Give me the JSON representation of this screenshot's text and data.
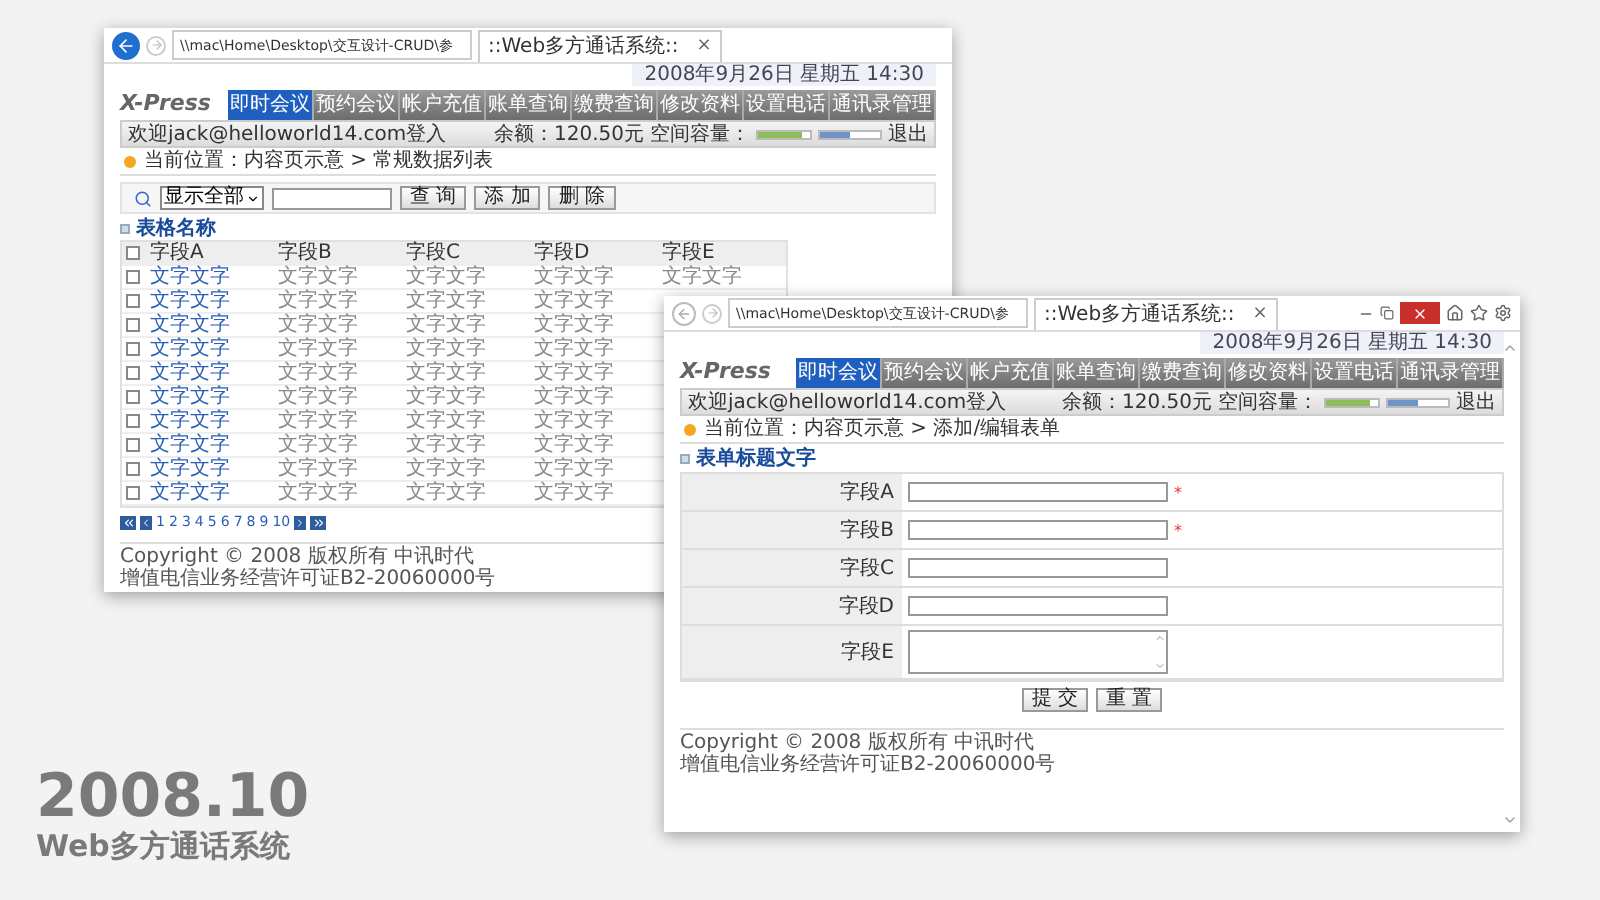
{
  "windows": [
    {
      "kind": "list",
      "address": "\\\\mac\\Home\\Desktop\\交互设计-CRUD\\参",
      "tab_title": "::Web多方通话系统::",
      "tab_close": "×",
      "date": "2008年9月26日  星期五  14:30",
      "logo": "X-Press",
      "nav": [
        {
          "label": "即时会议",
          "selected": true
        },
        {
          "label": "预约会议",
          "selected": false
        },
        {
          "label": "帐户充值",
          "selected": false
        },
        {
          "label": "账单查询",
          "selected": false
        },
        {
          "label": "缴费查询",
          "selected": false
        },
        {
          "label": "修改资料",
          "selected": false
        },
        {
          "label": "设置电话",
          "selected": false
        },
        {
          "label": "通讯录管理",
          "selected": false
        }
      ],
      "welcome": "欢迎jack@helloworld14.com登入",
      "balance": "余额：120.50元",
      "space_label": "空间容量：",
      "meters": [
        {
          "level": 0.85,
          "color": "#8cbf5a"
        },
        {
          "level": 0.5,
          "color": "#6f95c8"
        }
      ],
      "logout": "退出",
      "breadcrumb": "当前位置：内容页示意 > 常规数据列表",
      "search": {
        "select": "显示全部",
        "buttons": [
          "查 询",
          "添 加",
          "删 除"
        ]
      },
      "section_title": "表格名称",
      "table": {
        "select_all": {
          "checked": false
        },
        "columns": [
          "字段A",
          "字段B",
          "字段C",
          "字段D",
          "字段E"
        ],
        "rows": [
          {
            "checked": false,
            "cells": [
              "文字文字",
              "文字文字",
              "文字文字",
              "文字文字",
              "文字文字"
            ]
          },
          {
            "checked": false,
            "cells": [
              "文字文字",
              "文字文字",
              "文字文字",
              "文字文字"
            ]
          },
          {
            "checked": false,
            "cells": [
              "文字文字",
              "文字文字",
              "文字文字",
              "文字文字"
            ]
          },
          {
            "checked": false,
            "cells": [
              "文字文字",
              "文字文字",
              "文字文字",
              "文字文字"
            ]
          },
          {
            "checked": false,
            "cells": [
              "文字文字",
              "文字文字",
              "文字文字",
              "文字文字"
            ]
          },
          {
            "checked": false,
            "cells": [
              "文字文字",
              "文字文字",
              "文字文字",
              "文字文字"
            ]
          },
          {
            "checked": false,
            "cells": [
              "文字文字",
              "文字文字",
              "文字文字",
              "文字文字"
            ]
          },
          {
            "checked": false,
            "cells": [
              "文字文字",
              "文字文字",
              "文字文字",
              "文字文字"
            ]
          },
          {
            "checked": false,
            "cells": [
              "文字文字",
              "文字文字",
              "文字文字",
              "文字文字"
            ]
          },
          {
            "checked": false,
            "cells": [
              "文字文字",
              "文字文字",
              "文字文字",
              "文字文字"
            ]
          }
        ]
      },
      "pages": [
        "1",
        "2",
        "3",
        "4",
        "5",
        "6",
        "7",
        "8",
        "9",
        "10"
      ],
      "copyright": "Copyright © 2008 版权所有 中讯时代",
      "license": "增值电信业务经营许可证B2-20060000号"
    },
    {
      "kind": "form",
      "address": "\\\\mac\\Home\\Desktop\\交互设计-CRUD\\参",
      "tab_title": "::Web多方通话系统::",
      "tab_close": "×",
      "date": "2008年9月26日  星期五  14:30",
      "logo": "X-Press",
      "nav": [
        {
          "label": "即时会议",
          "selected": true
        },
        {
          "label": "预约会议",
          "selected": false
        },
        {
          "label": "帐户充值",
          "selected": false
        },
        {
          "label": "账单查询",
          "selected": false
        },
        {
          "label": "缴费查询",
          "selected": false
        },
        {
          "label": "修改资料",
          "selected": false
        },
        {
          "label": "设置电话",
          "selected": false
        },
        {
          "label": "通讯录管理",
          "selected": false
        }
      ],
      "welcome": "欢迎jack@helloworld14.com登入",
      "balance": "余额：120.50元",
      "space_label": "空间容量：",
      "meters": [
        {
          "level": 0.85,
          "color": "#8cbf5a"
        },
        {
          "level": 0.5,
          "color": "#6f95c8"
        }
      ],
      "logout": "退出",
      "breadcrumb": "当前位置：内容页示意 > 添加/编辑表单",
      "section_title": "表单标题文字",
      "form": {
        "rows": [
          {
            "label": "字段A",
            "kind": "input",
            "mark": "*"
          },
          {
            "label": "字段B",
            "kind": "input",
            "mark": "*"
          },
          {
            "label": "字段C",
            "kind": "input"
          },
          {
            "label": "字段D",
            "kind": "input"
          },
          {
            "label": "字段E",
            "kind": "textarea"
          }
        ],
        "buttons": [
          "提 交",
          "重 置"
        ]
      },
      "copyright": "Copyright © 2008 版权所有 中讯时代",
      "license": "增值电信业务经营许可证B2-20060000号"
    }
  ],
  "slide": {
    "year": "2008.10",
    "title": "Web多方通话系统"
  }
}
